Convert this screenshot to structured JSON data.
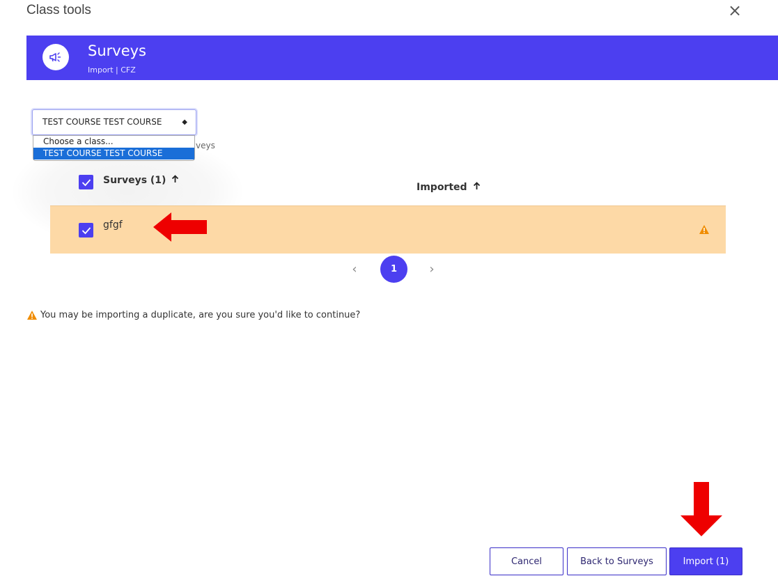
{
  "dialog": {
    "title": "Class tools",
    "close_glyph": "×"
  },
  "banner": {
    "icon": "megaphone-icon",
    "title": "Surveys",
    "subtitle": "Import | CFZ",
    "color": "#4c3ff0"
  },
  "class_select": {
    "value": "TEST COURSE TEST COURSE",
    "options": [
      "Choose a class...",
      "TEST COURSE TEST COURSE"
    ],
    "selected_index": 1,
    "obscured_label_tail": "veys"
  },
  "table": {
    "col_surveys": "Surveys (1)",
    "col_imported": "Imported",
    "sort_glyph": "🡑",
    "rows": [
      {
        "name": "gfgf",
        "checked": true,
        "imported_status": "warning"
      }
    ],
    "row_highlight_color": "#fdd9a6"
  },
  "pagination": {
    "prev": "‹",
    "current_page": "1",
    "next": "›"
  },
  "warning": {
    "message": "You may be importing a duplicate, are you sure you'd like to continue?",
    "color": "#f08c00"
  },
  "buttons": {
    "cancel": "Cancel",
    "back": "Back to Surveys",
    "import": "Import (1)"
  },
  "annotations": {
    "arrow_color": "#ee0000"
  }
}
